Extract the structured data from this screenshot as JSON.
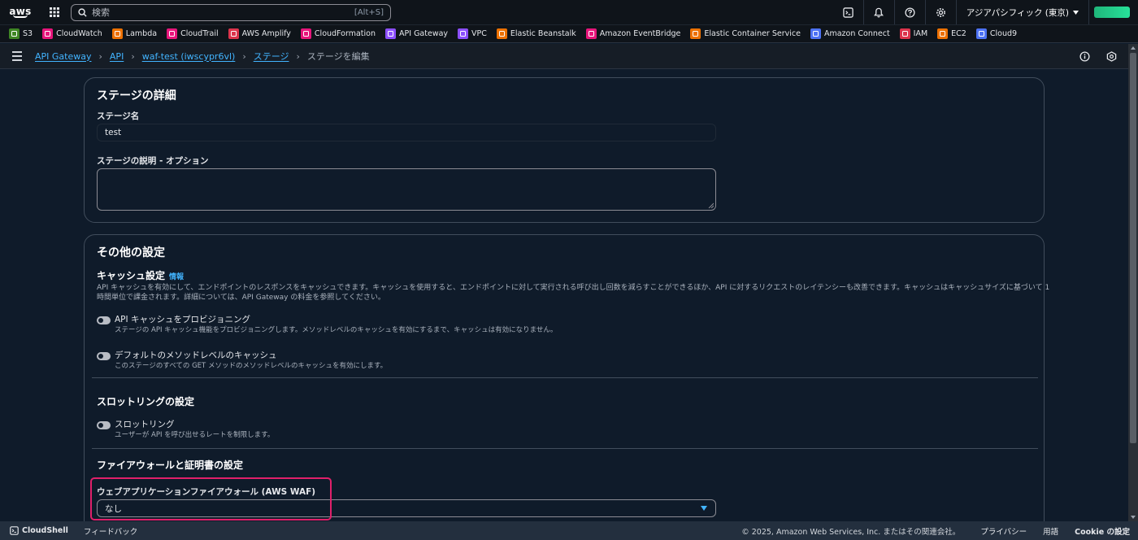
{
  "topbar": {
    "logo_text": "aws",
    "search_placeholder": "検索",
    "search_shortcut": "[Alt+S]",
    "region": "アジアパシフィック (東京)"
  },
  "favorites": [
    {
      "label": "S3",
      "color": "#3f8624",
      "icon": "s3-icon"
    },
    {
      "label": "CloudWatch",
      "color": "#e7157b",
      "icon": "cloudwatch-icon"
    },
    {
      "label": "Lambda",
      "color": "#ed7100",
      "icon": "lambda-icon"
    },
    {
      "label": "CloudTrail",
      "color": "#e7157b",
      "icon": "cloudtrail-icon"
    },
    {
      "label": "AWS Amplify",
      "color": "#dd344c",
      "icon": "amplify-icon"
    },
    {
      "label": "CloudFormation",
      "color": "#e7157b",
      "icon": "cloudformation-icon"
    },
    {
      "label": "API Gateway",
      "color": "#8c4fff",
      "icon": "api-gateway-icon"
    },
    {
      "label": "VPC",
      "color": "#8c4fff",
      "icon": "vpc-icon"
    },
    {
      "label": "Elastic Beanstalk",
      "color": "#ed7100",
      "icon": "beanstalk-icon"
    },
    {
      "label": "Amazon EventBridge",
      "color": "#e7157b",
      "icon": "eventbridge-icon"
    },
    {
      "label": "Elastic Container Service",
      "color": "#ed7100",
      "icon": "ecs-icon"
    },
    {
      "label": "Amazon Connect",
      "color": "#4d72f3",
      "icon": "connect-icon"
    },
    {
      "label": "IAM",
      "color": "#dd344c",
      "icon": "iam-icon"
    },
    {
      "label": "EC2",
      "color": "#ed7100",
      "icon": "ec2-icon"
    },
    {
      "label": "Cloud9",
      "color": "#4d72f3",
      "icon": "cloud9-icon"
    }
  ],
  "breadcrumb": {
    "items": [
      "API Gateway",
      "API",
      "waf-test (iwscypr6vl)",
      "ステージ"
    ],
    "current": "ステージを編集"
  },
  "stage_details": {
    "title": "ステージの詳細",
    "name_label": "ステージ名",
    "name_value": "test",
    "desc_label": "ステージの説明 - オプション"
  },
  "other_settings": {
    "title": "その他の設定",
    "cache": {
      "title": "キャッシュ設定",
      "info": "情報",
      "desc_line1": "API キャッシュを有効にして、エンドポイントのレスポンスをキャッシュできます。キャッシュを使用すると、エンドポイントに対して実行される呼び出し回数を減らすことができるほか、API に対するリクエストのレイテンシーも改善できます。キャッシュはキャッシュサイズに基づいて 1",
      "desc_line2": "時間単位で課金されます。詳細については、API Gateway の料金を参照してください。",
      "provision_title": "API キャッシュをプロビジョニング",
      "provision_sub": "ステージの API キャッシュ機能をプロビジョニングします。メソッドレベルのキャッシュを有効にするまで、キャッシュは有効になりません。",
      "method_title": "デフォルトのメソッドレベルのキャッシュ",
      "method_sub": "このステージのすべての GET メソッドのメソッドレベルのキャッシュを有効にします。"
    },
    "throttling": {
      "title": "スロットリングの設定",
      "toggle_title": "スロットリング",
      "toggle_sub": "ユーザーが API を呼び出せるレートを制限します。"
    },
    "firewall": {
      "title": "ファイアウォールと証明書の設定",
      "waf_label": "ウェブアプリケーションファイアウォール (AWS WAF)",
      "waf_value": "なし"
    }
  },
  "footer": {
    "cloudshell": "CloudShell",
    "feedback": "フィードバック",
    "copyright": "© 2025, Amazon Web Services, Inc. またはその関連会社。",
    "privacy": "プライバシー",
    "terms": "用語",
    "cookie": "Cookie の設定"
  }
}
